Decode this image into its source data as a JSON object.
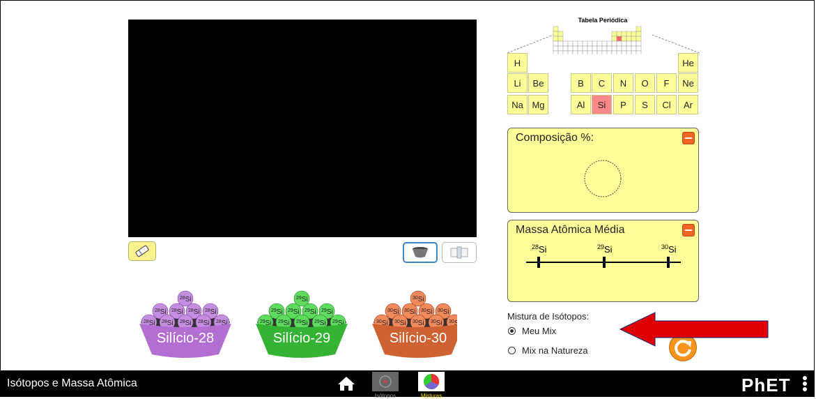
{
  "sim_title": "Isótopos e Massa Atômica",
  "periodic_table": {
    "title": "Tabela Periódica",
    "selected": "Si",
    "rows": [
      [
        "H",
        "",
        "",
        "",
        "",
        "",
        "",
        "He"
      ],
      [
        "Li",
        "Be",
        "B",
        "C",
        "N",
        "O",
        "F",
        "Ne"
      ],
      [
        "Na",
        "Mg",
        "Al",
        "Si",
        "P",
        "S",
        "Cl",
        "Ar"
      ]
    ]
  },
  "composition": {
    "title": "Composição %:"
  },
  "avg_mass": {
    "title": "Massa Atômica Média",
    "ticks": [
      {
        "mass": "28",
        "symbol": "Si"
      },
      {
        "mass": "29",
        "symbol": "Si"
      },
      {
        "mass": "30",
        "symbol": "Si"
      }
    ]
  },
  "mix": {
    "label": "Mistura de Isótopos:",
    "options": [
      {
        "label": "Meu Mix",
        "selected": true
      },
      {
        "label": "Mix na Natureza",
        "selected": false
      }
    ]
  },
  "buckets": [
    {
      "label": "Silício-28",
      "mass": "28",
      "symbol": "Si",
      "color": "#b26fd1",
      "ball": "#c58ee0",
      "dark": "#6e3d8c"
    },
    {
      "label": "Silício-29",
      "mass": "29",
      "symbol": "Si",
      "color": "#35b335",
      "ball": "#5fdc5f",
      "dark": "#1e7a1e"
    },
    {
      "label": "Silício-30",
      "mass": "30",
      "symbol": "Si",
      "color": "#cf6233",
      "ball": "#f08a5d",
      "dark": "#8a3515"
    }
  ],
  "nav": {
    "tabs": [
      {
        "label": "Isótopos",
        "active": false
      },
      {
        "label": "Misturas",
        "active": true
      }
    ],
    "logo": "PhET"
  },
  "colors": {
    "accent_orange": "#f26522",
    "panel_yellow": "#ffff99",
    "selected_red": "#ff8888",
    "arrow_red": "#e00000"
  }
}
